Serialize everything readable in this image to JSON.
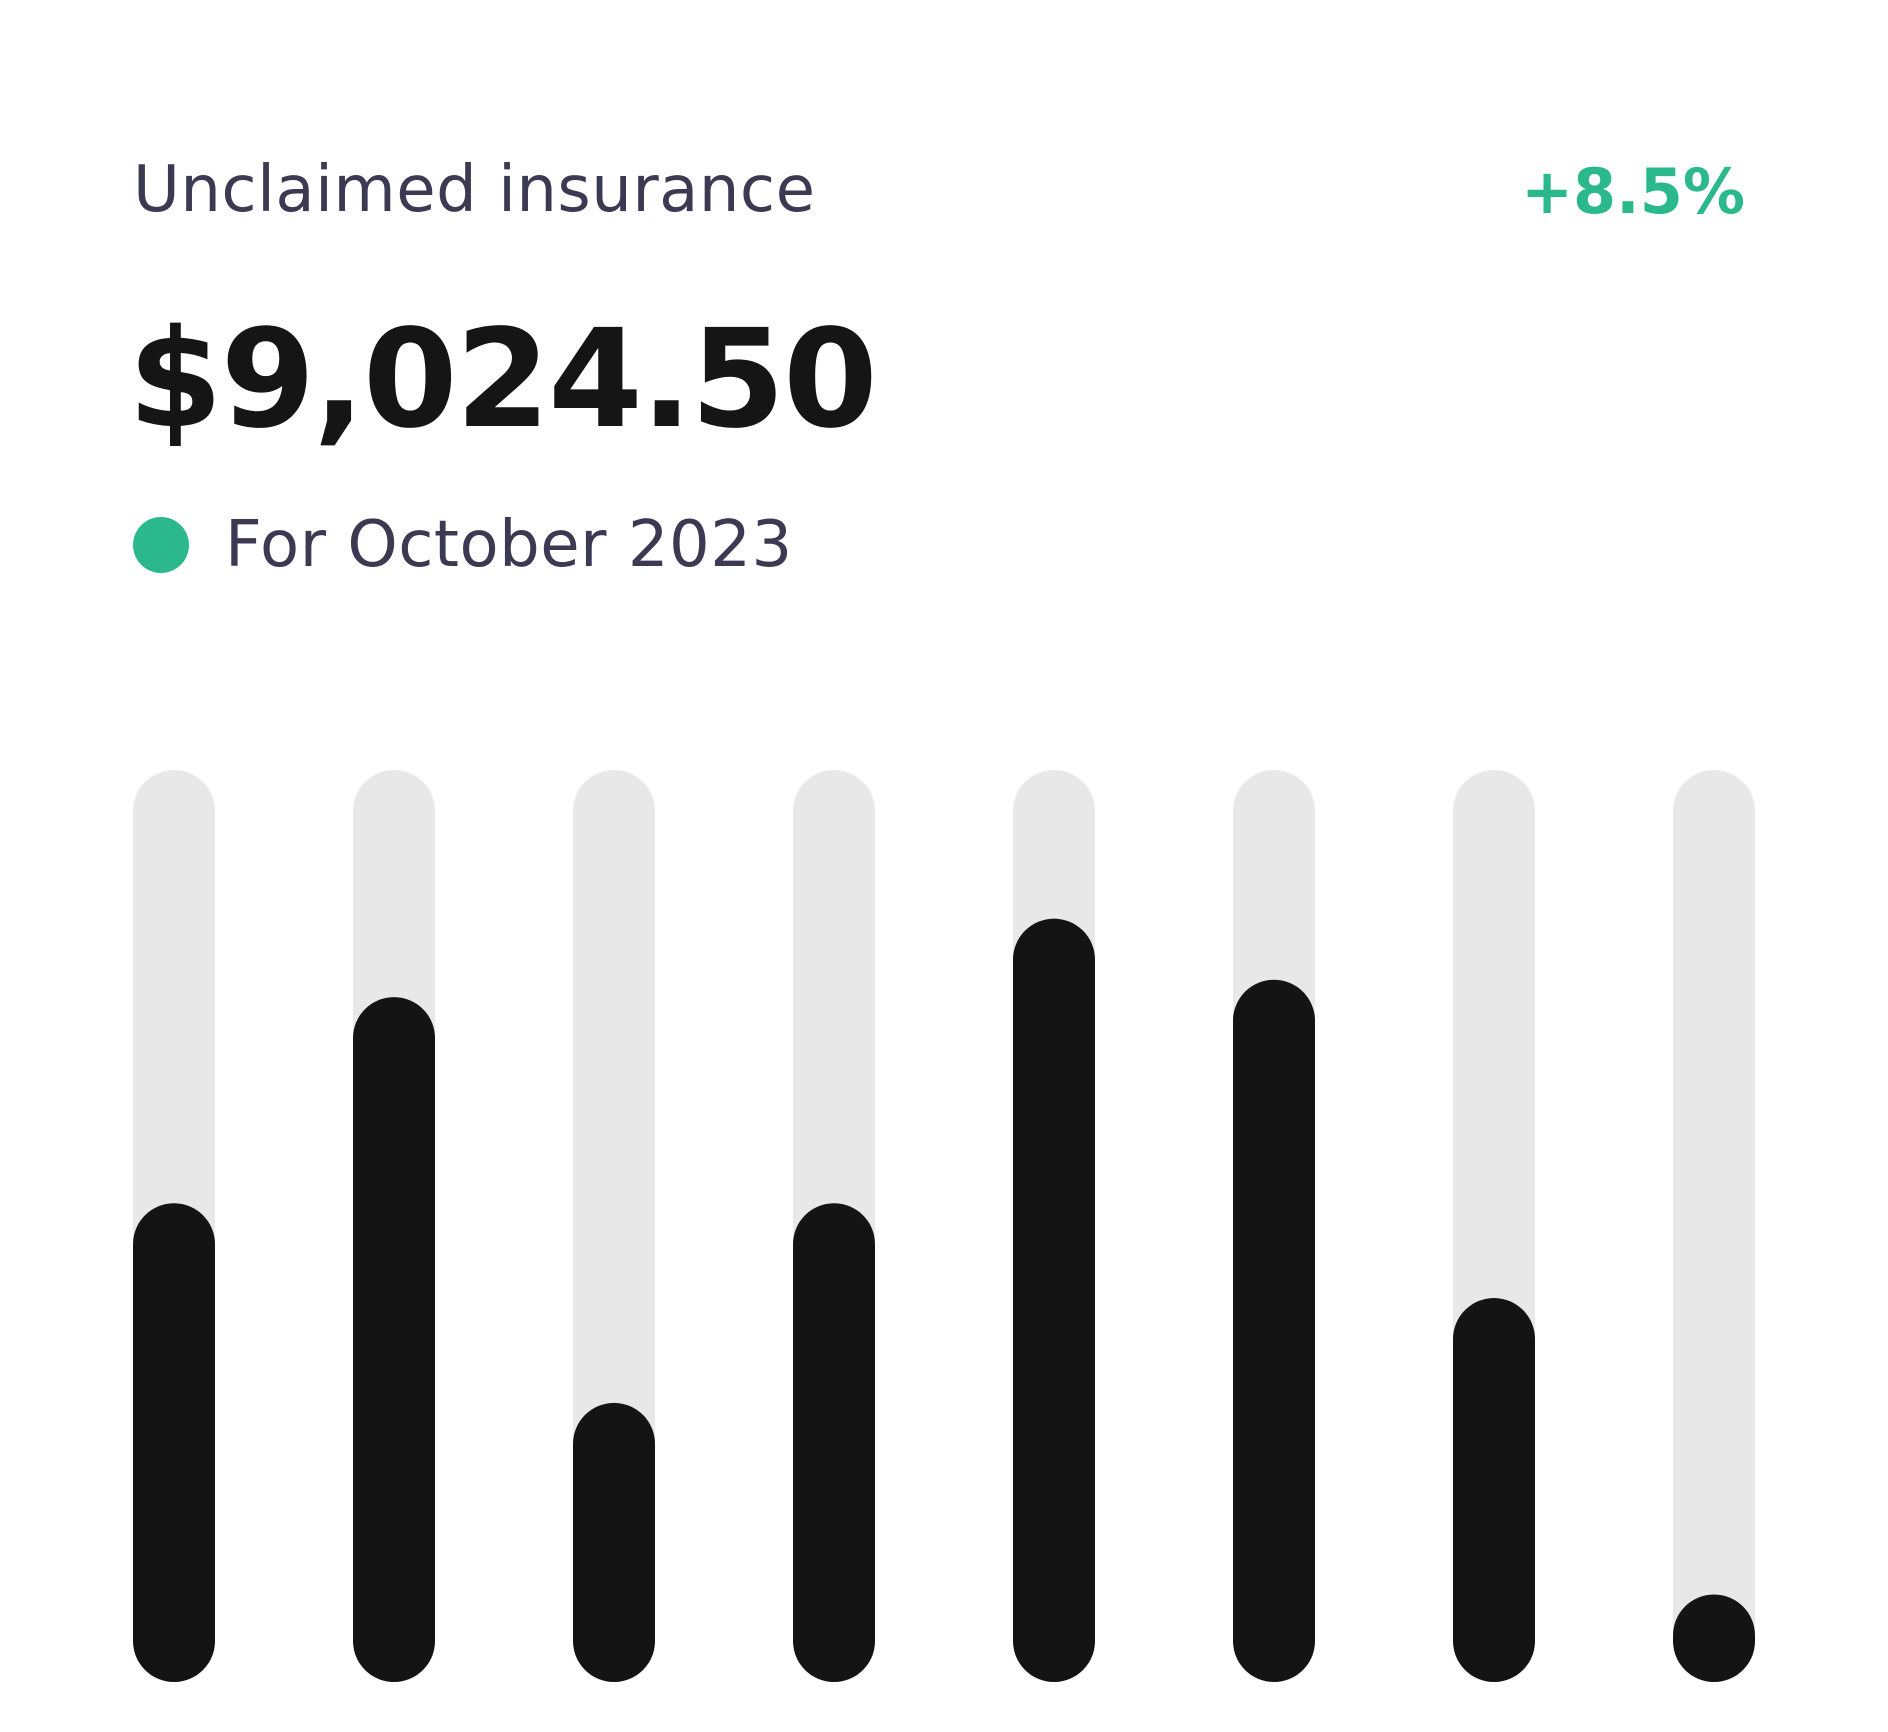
{
  "card": {
    "title": "Unclaimed insurance",
    "change": "+8.5%",
    "amount": "$9,024.50",
    "period_label": "For October 2023"
  },
  "colors": {
    "positive": "#2bb98c",
    "bar_fill": "#141414",
    "bar_track": "#e8e8e8",
    "text_secondary": "#3b3a52",
    "text_primary": "#151515"
  },
  "chart_data": {
    "type": "bar",
    "values": [
      0.525,
      0.751,
      0.306,
      0.525,
      0.837,
      0.77,
      0.421,
      0.096
    ],
    "max": 1,
    "track": true,
    "title": "",
    "xlabel": "",
    "ylabel": "",
    "grid": false
  }
}
